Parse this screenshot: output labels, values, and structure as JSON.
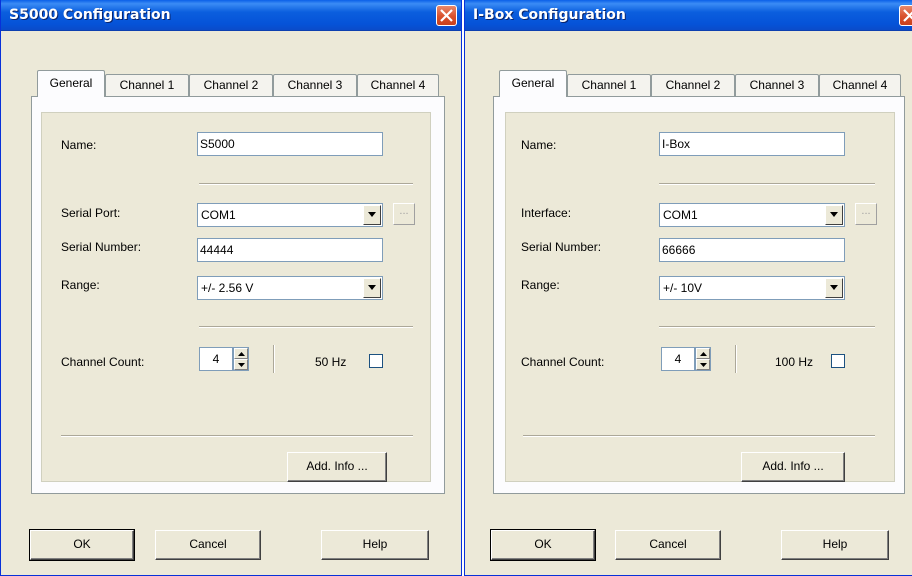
{
  "windows": [
    {
      "title": "S5000 Configuration",
      "tabs": [
        "General",
        "Channel 1",
        "Channel 2",
        "Channel 3",
        "Channel 4"
      ],
      "active_tab": "General",
      "name_label": "Name:",
      "name_value": "S5000",
      "port_label": "Serial Port:",
      "port_value": "COM1",
      "serial_label": "Serial Number:",
      "serial_value": "44444",
      "range_label": "Range:",
      "range_value": "+/- 2.56 V",
      "channel_count_label": "Channel Count:",
      "channel_count_value": "4",
      "hz_label": "50 Hz",
      "hz_checked": false,
      "ellipsis_label": "...",
      "add_info_label": "Add. Info ...",
      "ok_label": "OK",
      "cancel_label": "Cancel",
      "help_label": "Help"
    },
    {
      "title": "I-Box Configuration",
      "tabs": [
        "General",
        "Channel 1",
        "Channel 2",
        "Channel 3",
        "Channel 4"
      ],
      "active_tab": "General",
      "name_label": "Name:",
      "name_value": "I-Box",
      "port_label": "Interface:",
      "port_value": "COM1",
      "serial_label": "Serial Number:",
      "serial_value": "66666",
      "range_label": "Range:",
      "range_value": "+/- 10V",
      "channel_count_label": "Channel Count:",
      "channel_count_value": "4",
      "hz_label": "100 Hz",
      "hz_checked": false,
      "ellipsis_label": "...",
      "add_info_label": "Add. Info ...",
      "ok_label": "OK",
      "cancel_label": "Cancel",
      "help_label": "Help"
    }
  ],
  "colors": {
    "titlebar": "#0553d8",
    "dialog_bg": "#ece9d8",
    "close_button": "#d9512c"
  }
}
